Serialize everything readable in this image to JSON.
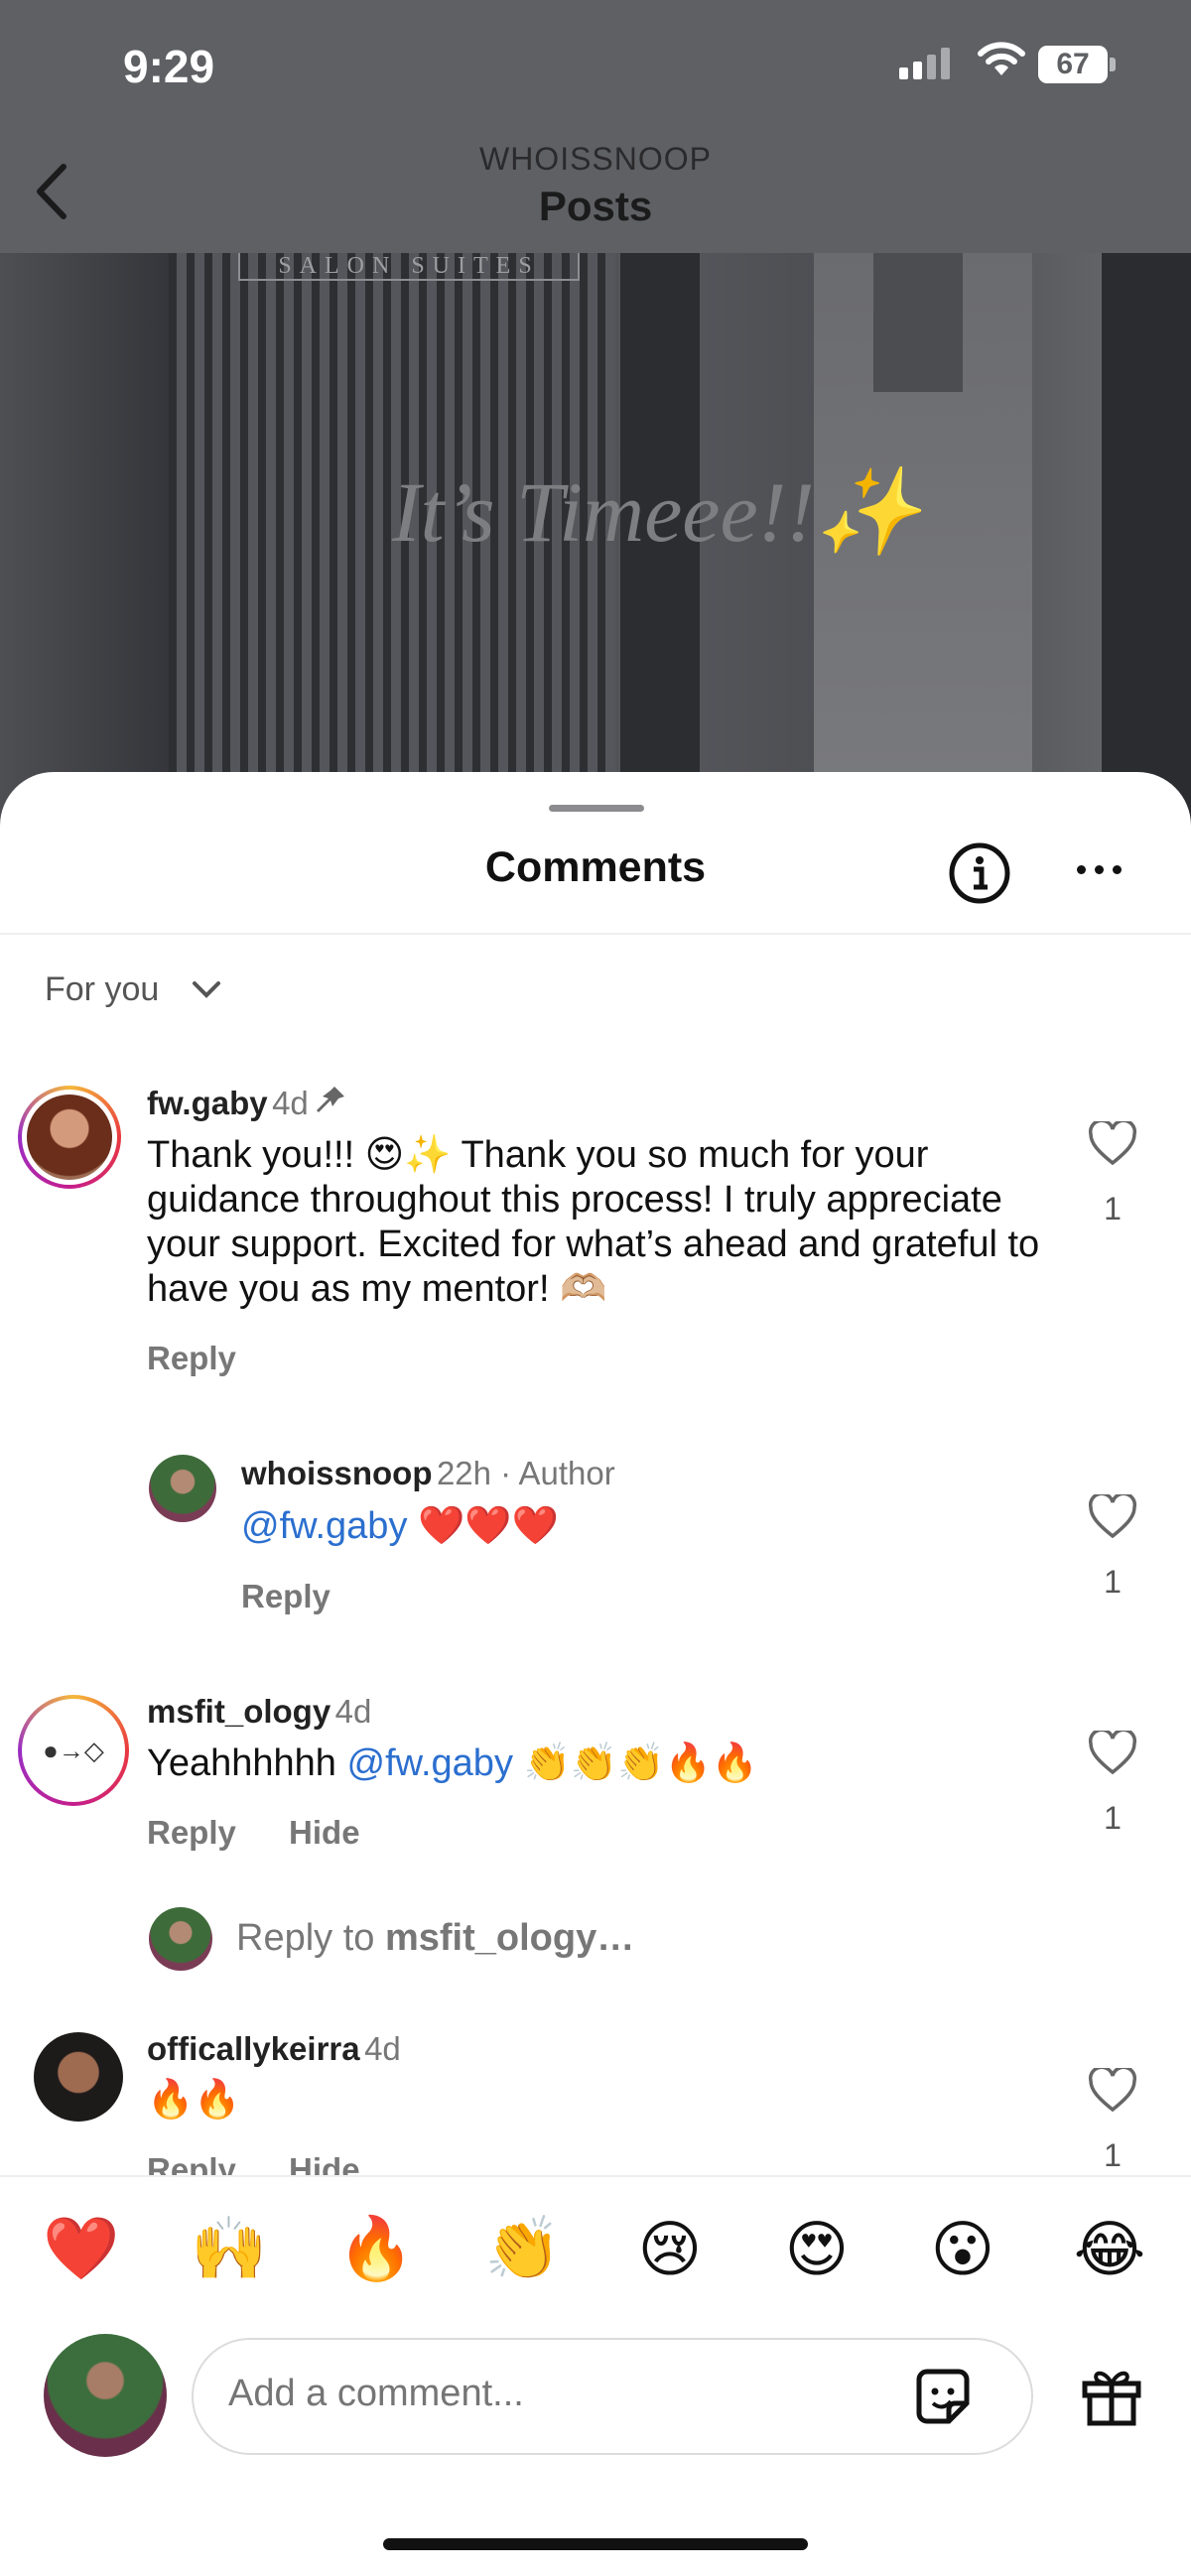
{
  "status_bar": {
    "time": "9:29",
    "battery": "67"
  },
  "header": {
    "account": "WHOISSNOOP",
    "title": "Posts"
  },
  "post_image": {
    "overlay_text": "It’s Timeee!!✨",
    "sign_text": "SALON SUITES"
  },
  "comments_sheet": {
    "title": "Comments",
    "filter": "For you",
    "comments": [
      {
        "username": "fw.gaby",
        "time": "4d",
        "text": "Thank you!!! 😍✨ Thank you so much for your guidance throughout this process! I truly appreciate your support. Excited for what’s ahead and grateful to have you as my mentor! 🫶🏼",
        "reply_label": "Reply",
        "likes": "1"
      },
      {
        "username": "whoissnoop",
        "time": "22h · Author",
        "mention": "@fw.gaby",
        "text": "❤️❤️❤️",
        "reply_label": "Reply",
        "likes": "1"
      },
      {
        "username": "msfit_ology",
        "time": "4d",
        "text_before": "Yeahhhhhh",
        "mention": "@fw.gaby",
        "text": "👏👏👏🔥🔥",
        "reply_label": "Reply",
        "hide_label": "Hide",
        "likes": "1"
      },
      {
        "username": "officallykeirra",
        "time": "4d",
        "text": "🔥🔥",
        "reply_label": "Reply",
        "hide_label": "Hide",
        "likes": "1"
      }
    ],
    "reply_to": {
      "prefix": "Reply to",
      "username": "msfit_ology…"
    }
  },
  "reactions": [
    "❤️",
    "🙌",
    "🔥",
    "👏",
    "😢",
    "😍",
    "😮",
    "😂"
  ],
  "composer": {
    "placeholder": "Add a comment..."
  }
}
